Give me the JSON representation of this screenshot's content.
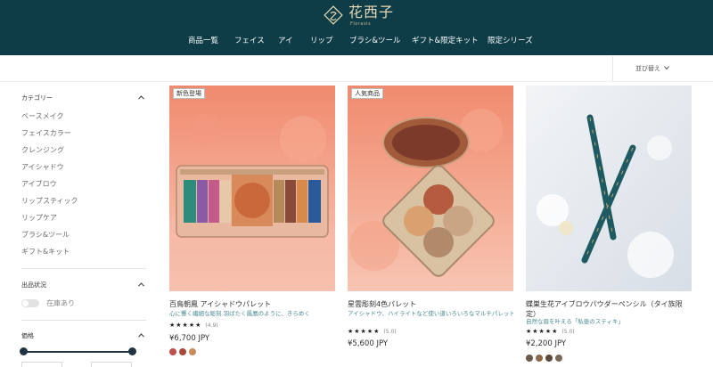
{
  "brand": {
    "name": "花西子",
    "sub": "Florasis",
    "header_color": "#0e3d47"
  },
  "nav": {
    "items": [
      "商品一覧",
      "フェイス",
      "アイ",
      "リップ",
      "ブラシ&ツール",
      "ギフト&限定キット",
      "限定シリーズ"
    ]
  },
  "sort": {
    "label": "並び替え",
    "icon": "chevron-down-icon"
  },
  "sidebar": {
    "category": {
      "title": "カテゴリー",
      "items": [
        "ベースメイク",
        "フェイスカラー",
        "クレンジング",
        "アイシャドウ",
        "アイブロウ",
        "リップスティック",
        "リップケア",
        "ブラシ&ツール",
        "ギフト&キット"
      ]
    },
    "stock": {
      "title": "出品状況",
      "toggle_label": "在庫あり",
      "toggle_on": false
    },
    "price": {
      "title": "価格"
    }
  },
  "products": [
    {
      "badge": "新色登場",
      "name": "百鳥朝鳳 アイシャドウパレット",
      "desc": "心に響く繊細な彫刻 羽ばたく鳳凰のように、きらめく",
      "rating_stars": "★★★★★",
      "rating": "(4.9)",
      "rating_value": 4.9,
      "price": "¥6,700 JPY",
      "swatches": [
        "#c0504d",
        "#a84a3a",
        "#c98b5a"
      ]
    },
    {
      "badge": "人気商品",
      "name": "星雲彫刻4色パレット",
      "desc": "アイシャドウ、ハイライトなど使い道いろいろなマルチパレット",
      "rating_stars": "★★★★★",
      "rating": "(5.0)",
      "rating_value": 5.0,
      "price": "¥5,600 JPY",
      "swatches": []
    },
    {
      "badge": "",
      "name": "蝶巣生花アイブロウパウダーペンシル（タイ族限定）",
      "desc": "自然な眉を叶える「私壺のスティキ」",
      "rating_stars": "★★★★★",
      "rating": "(5.0)",
      "rating_value": 5.0,
      "price": "¥2,200 JPY",
      "swatches": [
        "#6b5a4a",
        "#8a6a4a",
        "#5a4a3a",
        "#7a6a5a"
      ]
    }
  ]
}
